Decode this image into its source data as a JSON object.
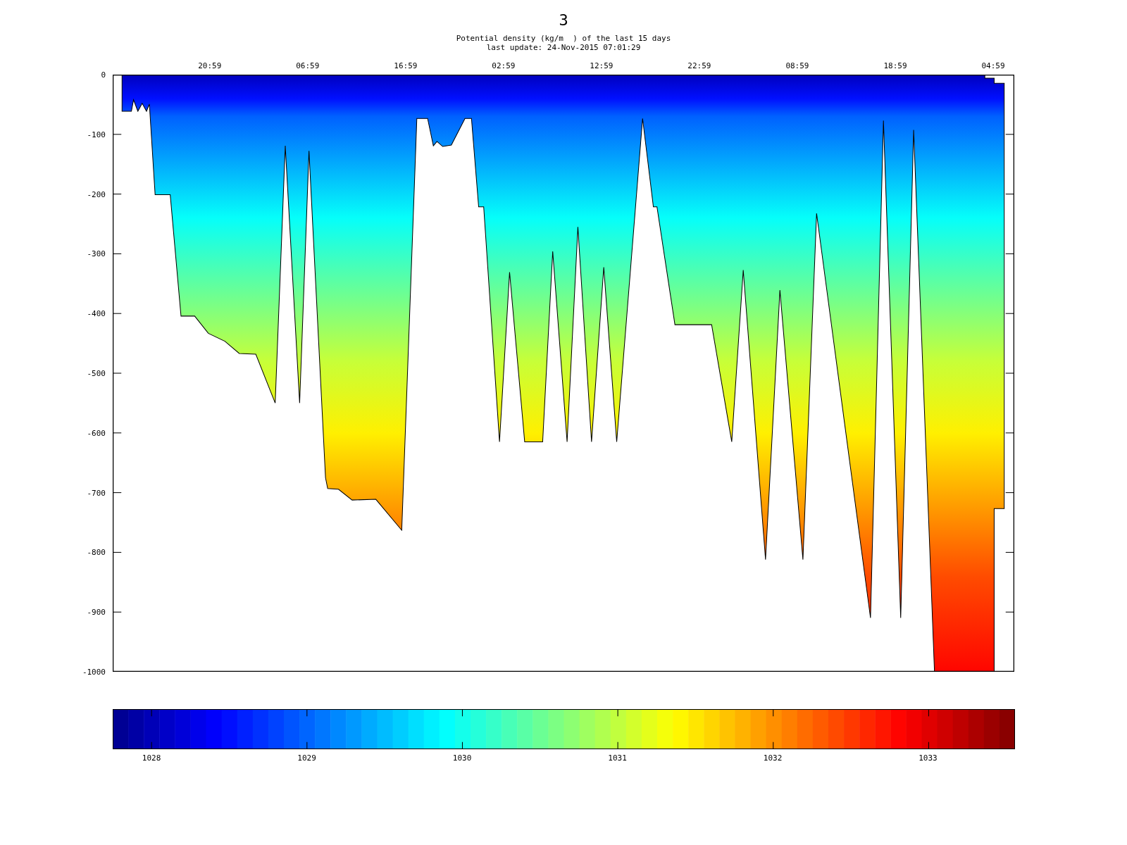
{
  "title": "3",
  "subtitle": "Potential density (kg/m  ) of the last 15 days",
  "update": "last update: 24-Nov-2015 07:01:29",
  "x_ticks": [
    "20:59",
    "06:59",
    "16:59",
    "02:59",
    "12:59",
    "22:59",
    "08:59",
    "18:59",
    "04:59"
  ],
  "y_ticks": [
    "0",
    "-100",
    "-200",
    "-300",
    "-400",
    "-500",
    "-600",
    "-700",
    "-800",
    "-900",
    "-1000"
  ],
  "colorbar_ticks": [
    "1028",
    "1029",
    "1030",
    "1031",
    "1032",
    "1033"
  ]
}
